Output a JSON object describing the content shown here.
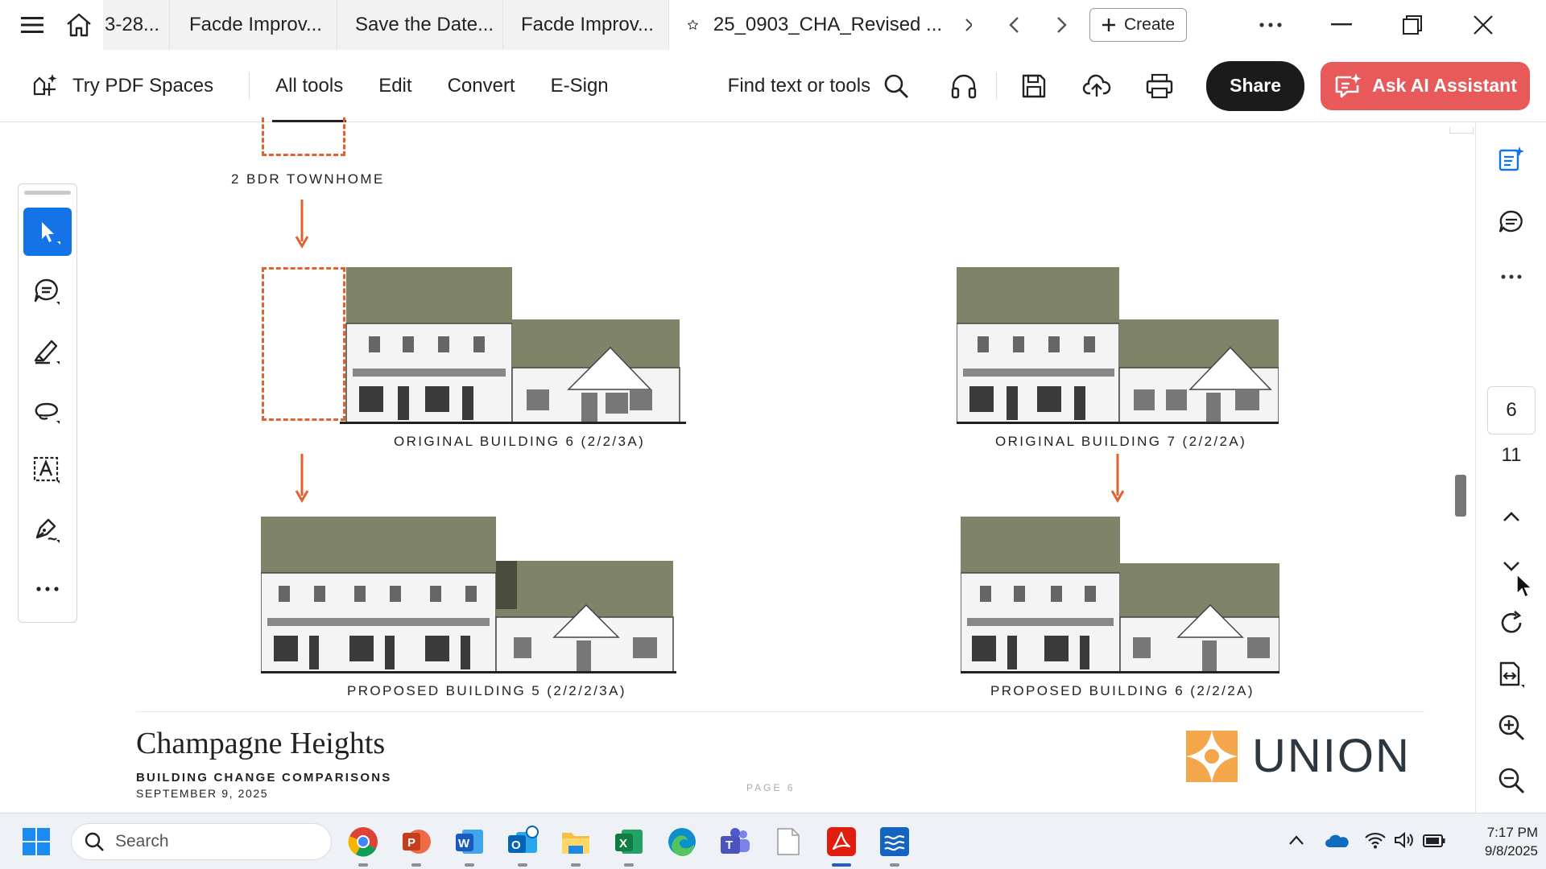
{
  "tabbar": {
    "tabs": [
      {
        "label": "3-28..."
      },
      {
        "label": "Facde Improv..."
      },
      {
        "label": "Save the Date..."
      },
      {
        "label": "Facde Improv..."
      },
      {
        "label": "25_0903_CHA_Revised ..."
      }
    ],
    "create_label": "Create"
  },
  "toolbar": {
    "spaces_label": "Try PDF Spaces",
    "links": [
      "All tools",
      "Edit",
      "Convert",
      "E-Sign"
    ],
    "find_label": "Find text or tools",
    "share_label": "Share",
    "ai_label": "Ask AI Assistant"
  },
  "doc": {
    "captions": {
      "top": "2 BDR TOWNHOME",
      "orig6": "ORIGINAL BUILDING 6 (2/2/3A)",
      "orig7": "ORIGINAL BUILDING 7 (2/2/2A)",
      "prop5": "PROPOSED BUILDING 5 (2/2/2/3A)",
      "prop6": "PROPOSED BUILDING 6 (2/2/2A)"
    },
    "footer": {
      "title": "Champagne Heights",
      "subtitle": "BUILDING CHANGE COMPARISONS",
      "date": "SEPTEMBER 9, 2025",
      "page": "PAGE 6",
      "logo_text": "UNION"
    },
    "colors": {
      "accent": "#e0622e",
      "roof": "#7f8468",
      "logo_orange": "#f4a74a"
    }
  },
  "right_panel": {
    "current_page": "6",
    "total_pages": "11"
  },
  "taskbar": {
    "search_placeholder": "Search",
    "time": "7:17 PM",
    "date": "9/8/2025"
  }
}
